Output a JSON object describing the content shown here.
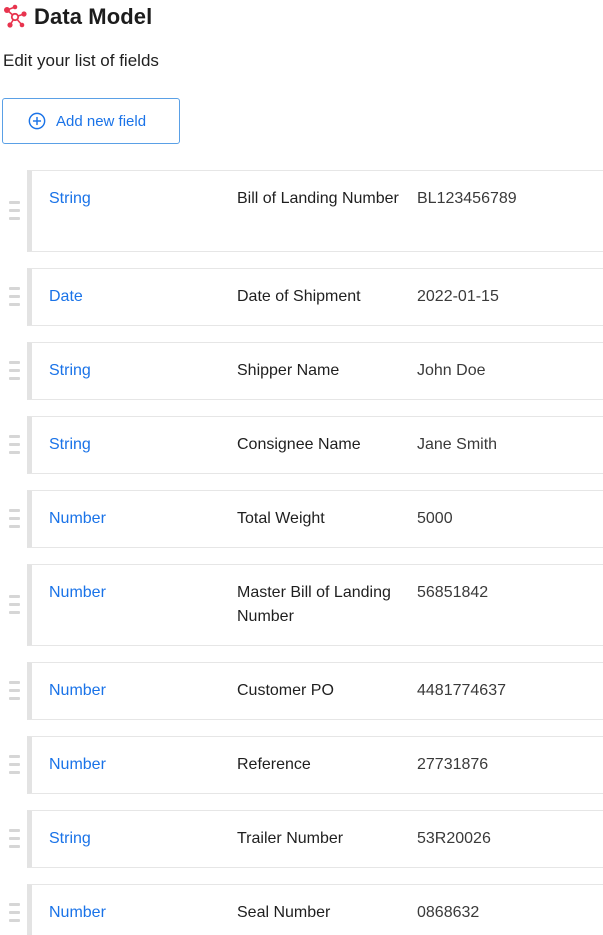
{
  "header": {
    "title": "Data Model",
    "logo_icon": "network-graph-icon",
    "logo_color": "#e8344e"
  },
  "subtitle": "Edit your list of fields",
  "add_button": {
    "label": "Add new field",
    "icon": "plus-circle-icon",
    "color": "#1a73e8"
  },
  "fields": [
    {
      "type": "String",
      "name": "Bill of Landing Number",
      "value": "BL123456789"
    },
    {
      "type": "Date",
      "name": "Date of Shipment",
      "value": "2022-01-15"
    },
    {
      "type": "String",
      "name": "Shipper Name",
      "value": "John Doe"
    },
    {
      "type": "String",
      "name": "Consignee Name",
      "value": "Jane Smith"
    },
    {
      "type": "Number",
      "name": "Total Weight",
      "value": "5000"
    },
    {
      "type": "Number",
      "name": "Master Bill of Landing Number",
      "value": "56851842"
    },
    {
      "type": "Number",
      "name": "Customer PO",
      "value": "4481774637"
    },
    {
      "type": "Number",
      "name": "Reference",
      "value": "27731876"
    },
    {
      "type": "String",
      "name": "Trailer Number",
      "value": "53R20026"
    },
    {
      "type": "Number",
      "name": "Seal Number",
      "value": "0868632"
    }
  ]
}
